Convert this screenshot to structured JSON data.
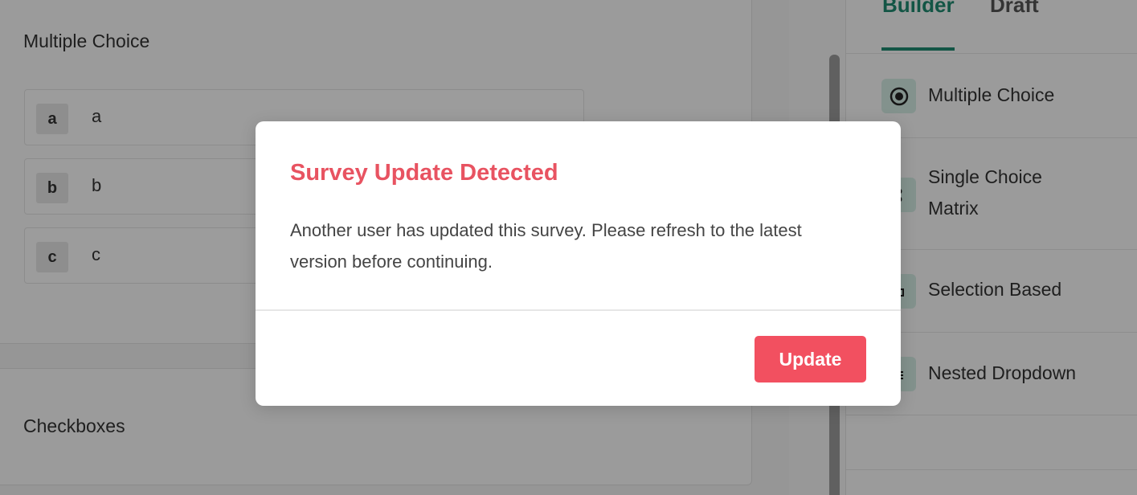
{
  "editor": {
    "question1": {
      "title": "Multiple Choice",
      "options": [
        {
          "key": "a",
          "text": "a"
        },
        {
          "key": "b",
          "text": "b"
        },
        {
          "key": "c",
          "text": "c"
        }
      ]
    },
    "question2": {
      "title": "Checkboxes"
    }
  },
  "panel": {
    "tabs": [
      {
        "label": "Builder",
        "active": true
      },
      {
        "label": "Draft",
        "active": false
      }
    ],
    "items": [
      {
        "label": "Multiple Choice",
        "icon": "radio-icon"
      },
      {
        "label_line1": "Single Choice",
        "label_line2": "Matrix",
        "icon": "matrix-icon"
      },
      {
        "label": "Selection Based",
        "icon": "selection-icon"
      },
      {
        "label": "Nested Dropdown",
        "icon": "nested-dropdown-icon"
      }
    ]
  },
  "modal": {
    "title": "Survey Update Detected",
    "message": "Another user has updated this survey. Please refresh to the latest version before continuing.",
    "button_label": "Update"
  },
  "colors": {
    "accent": "#1f8a70",
    "danger": "#f25060",
    "title_red": "#e85361"
  }
}
